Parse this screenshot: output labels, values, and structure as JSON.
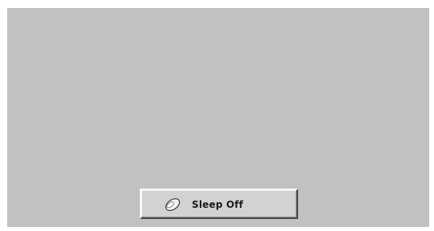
{
  "screen": {
    "background_color": "#c1c1c1"
  },
  "sleep_button": {
    "label": "Sleep Off",
    "icon": "moon-icon"
  }
}
